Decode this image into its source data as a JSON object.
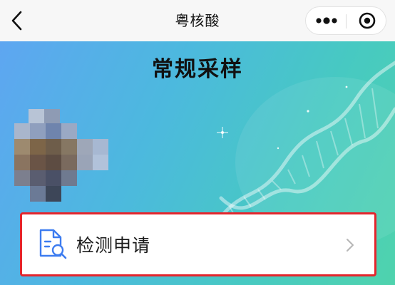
{
  "nav": {
    "title": "粤核酸"
  },
  "page": {
    "title": "常规采样"
  },
  "card": {
    "item_label": "检测申请"
  },
  "colors": {
    "nav_background": "#f7f7f7",
    "banner_gradient_start": "#5ea6f1",
    "banner_gradient_end": "#4fd3ad",
    "highlight_border": "#e4252c",
    "icon_blue": "#3d7cf0"
  },
  "icons": {
    "back": "chevron-left-icon",
    "more": "more-dots-icon",
    "close": "target-circle-icon",
    "item": "document-search-icon",
    "arrow": "chevron-right-icon",
    "decoration": "dna-helix-icon"
  },
  "avatar": {
    "state": "pixelated"
  }
}
